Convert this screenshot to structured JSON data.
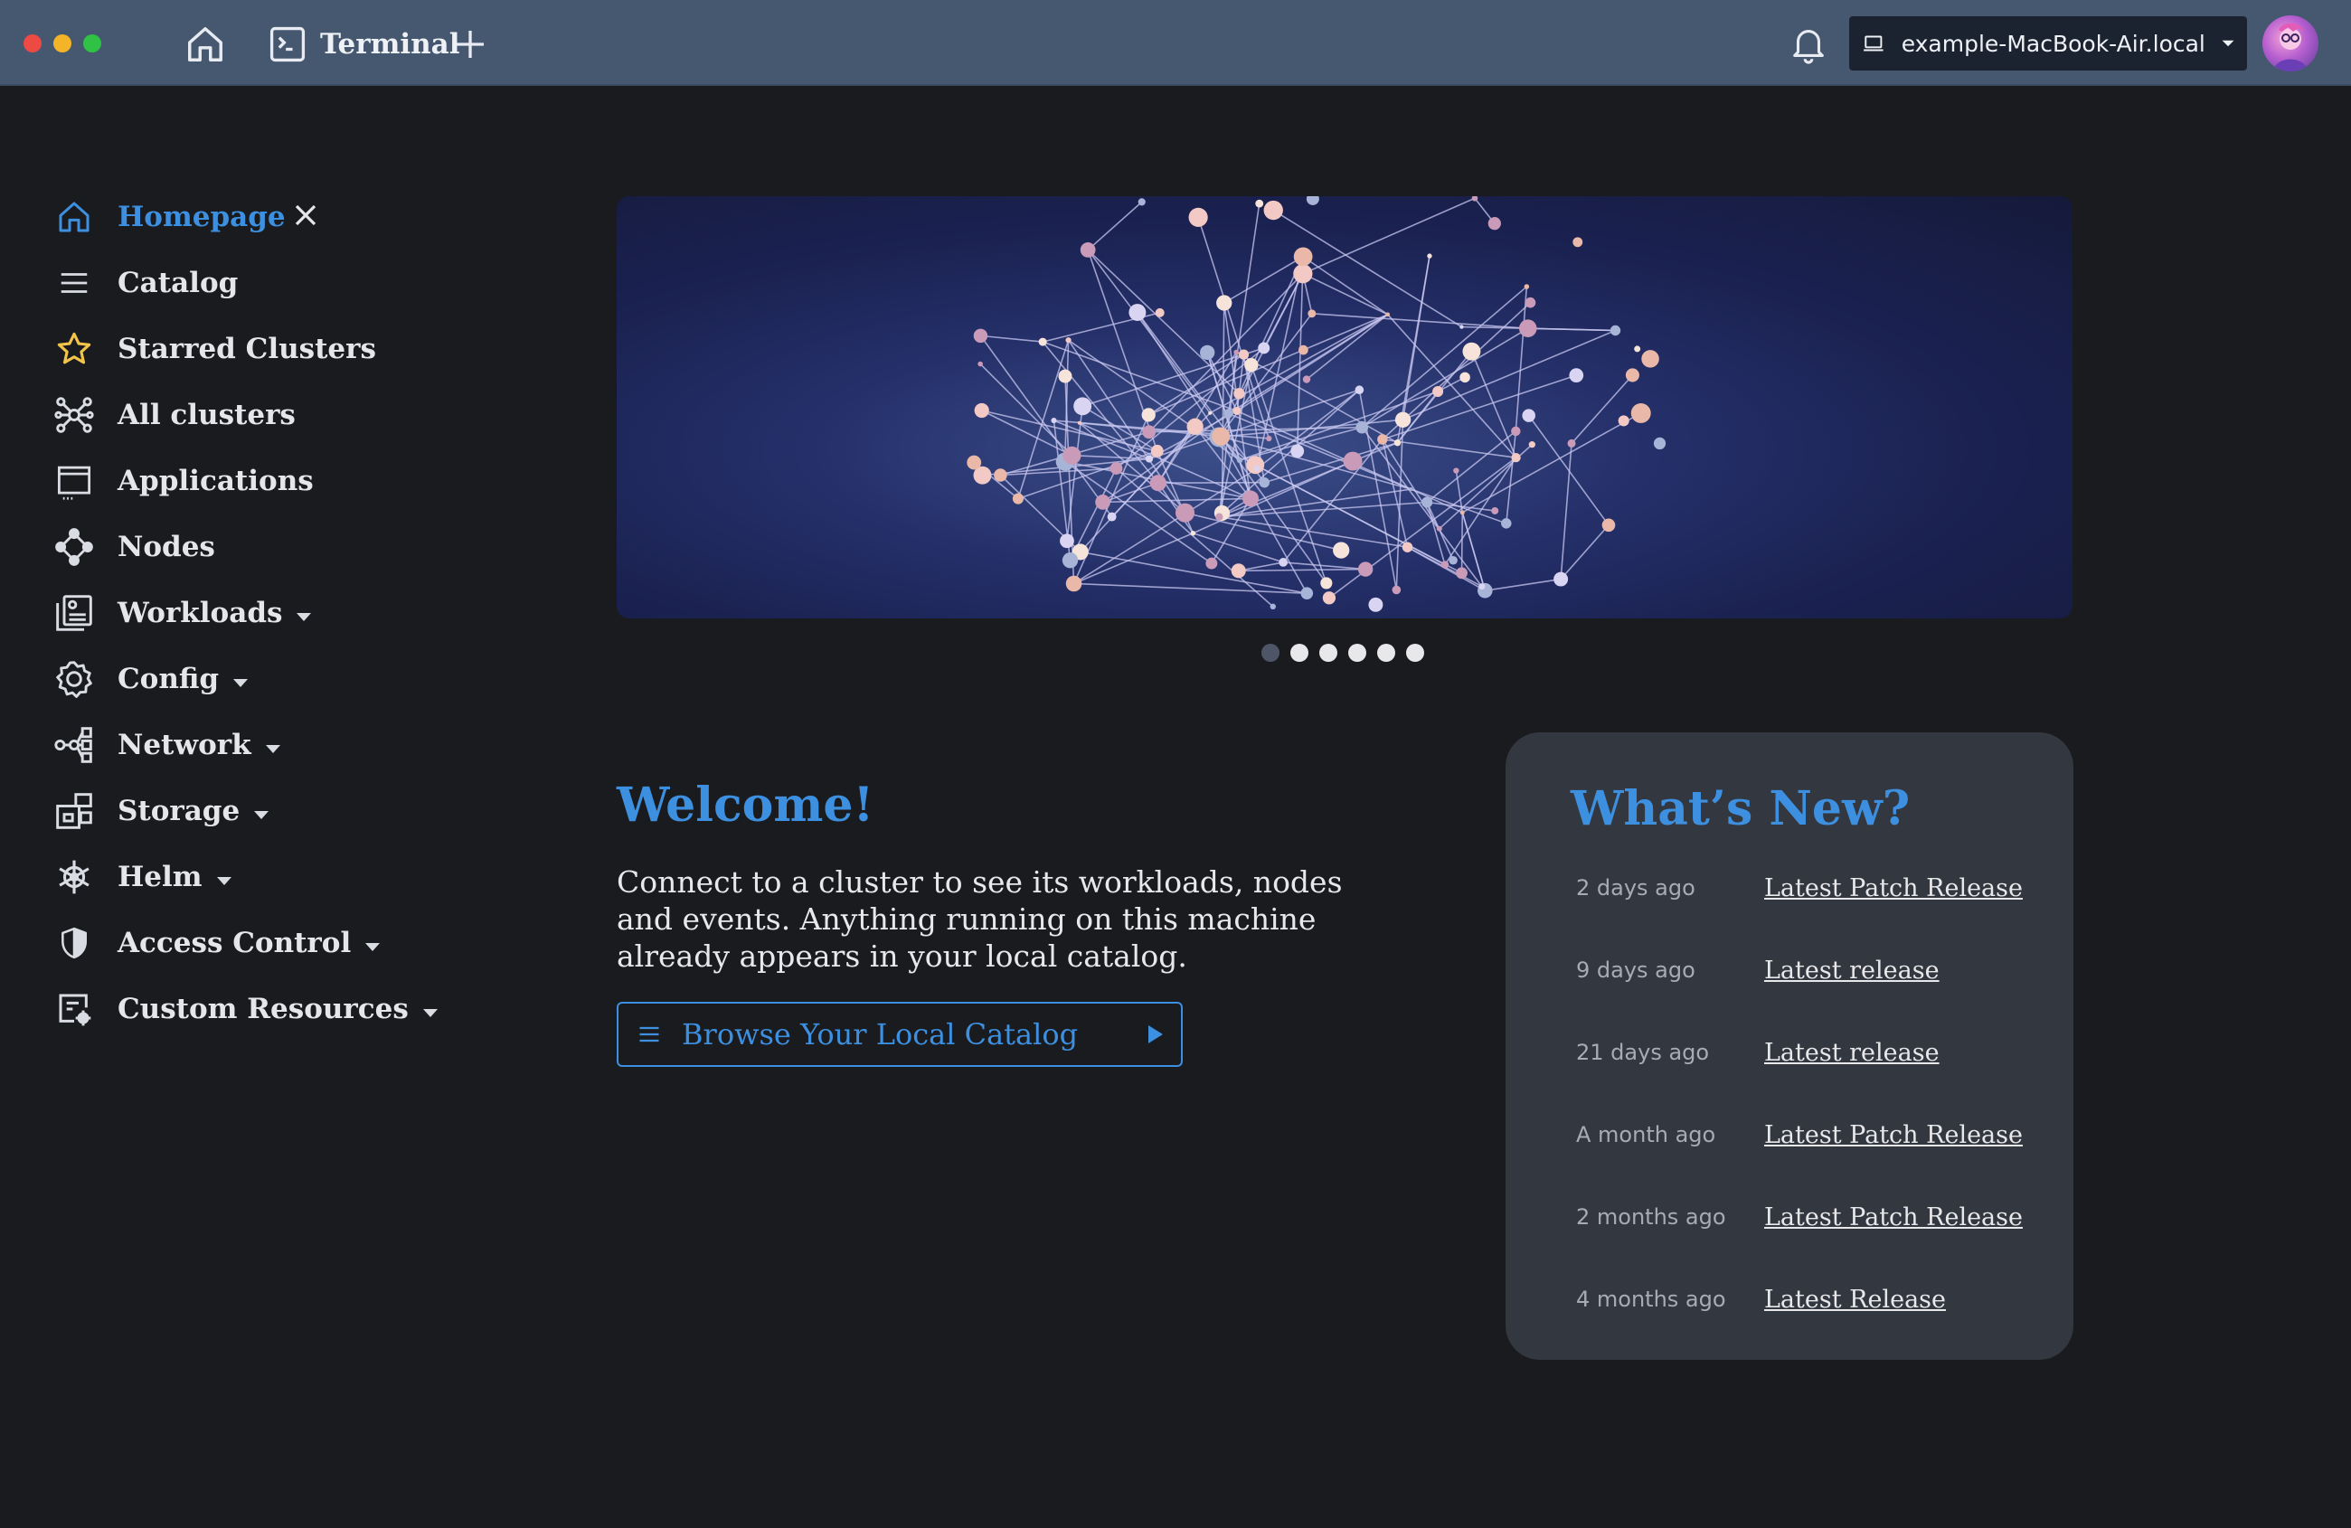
{
  "topbar": {
    "terminal_label": "Terminal",
    "host_label": "example-MacBook-Air.local"
  },
  "sidebar": {
    "items": [
      {
        "label": "Homepage",
        "icon": "home-icon",
        "active": true
      },
      {
        "label": "Catalog",
        "icon": "list-icon"
      },
      {
        "label": "Starred Clusters",
        "icon": "star-icon"
      },
      {
        "label": "All clusters",
        "icon": "cluster-icon"
      },
      {
        "label": "Applications",
        "icon": "window-icon"
      },
      {
        "label": "Nodes",
        "icon": "nodes-icon"
      },
      {
        "label": "Workloads",
        "icon": "workloads-icon",
        "expandable": true
      },
      {
        "label": "Config",
        "icon": "gear-icon",
        "expandable": true
      },
      {
        "label": "Network",
        "icon": "network-icon",
        "expandable": true
      },
      {
        "label": "Storage",
        "icon": "storage-icon",
        "expandable": true
      },
      {
        "label": "Helm",
        "icon": "helm-icon",
        "expandable": true
      },
      {
        "label": "Access Control",
        "icon": "shield-icon",
        "expandable": true
      },
      {
        "label": "Custom Resources",
        "icon": "custom-resources-icon",
        "expandable": true
      }
    ]
  },
  "hero": {
    "slide_count": 6,
    "active_slide": 1
  },
  "welcome": {
    "title": "Welcome!",
    "body": "Connect to a cluster to see its workloads, nodes and events. Anything running on this machine already appears in your local catalog.",
    "browse_label": "Browse Your Local Catalog"
  },
  "news": {
    "title": "What’s New?",
    "rows": [
      {
        "age": "2 days ago",
        "link": "Latest Patch Release"
      },
      {
        "age": "9 days ago",
        "link": "Latest release"
      },
      {
        "age": "21 days ago",
        "link": "Latest release"
      },
      {
        "age": "A month ago",
        "link": "Latest Patch Release"
      },
      {
        "age": "2 months ago",
        "link": "Latest Patch Release"
      },
      {
        "age": "4 months ago",
        "link": "Latest Release"
      }
    ]
  },
  "colors": {
    "accent": "#3d8fe0",
    "topbar": "#465870",
    "background": "#1a1b1e",
    "card": "#33373f",
    "star": "#f3c44a"
  }
}
